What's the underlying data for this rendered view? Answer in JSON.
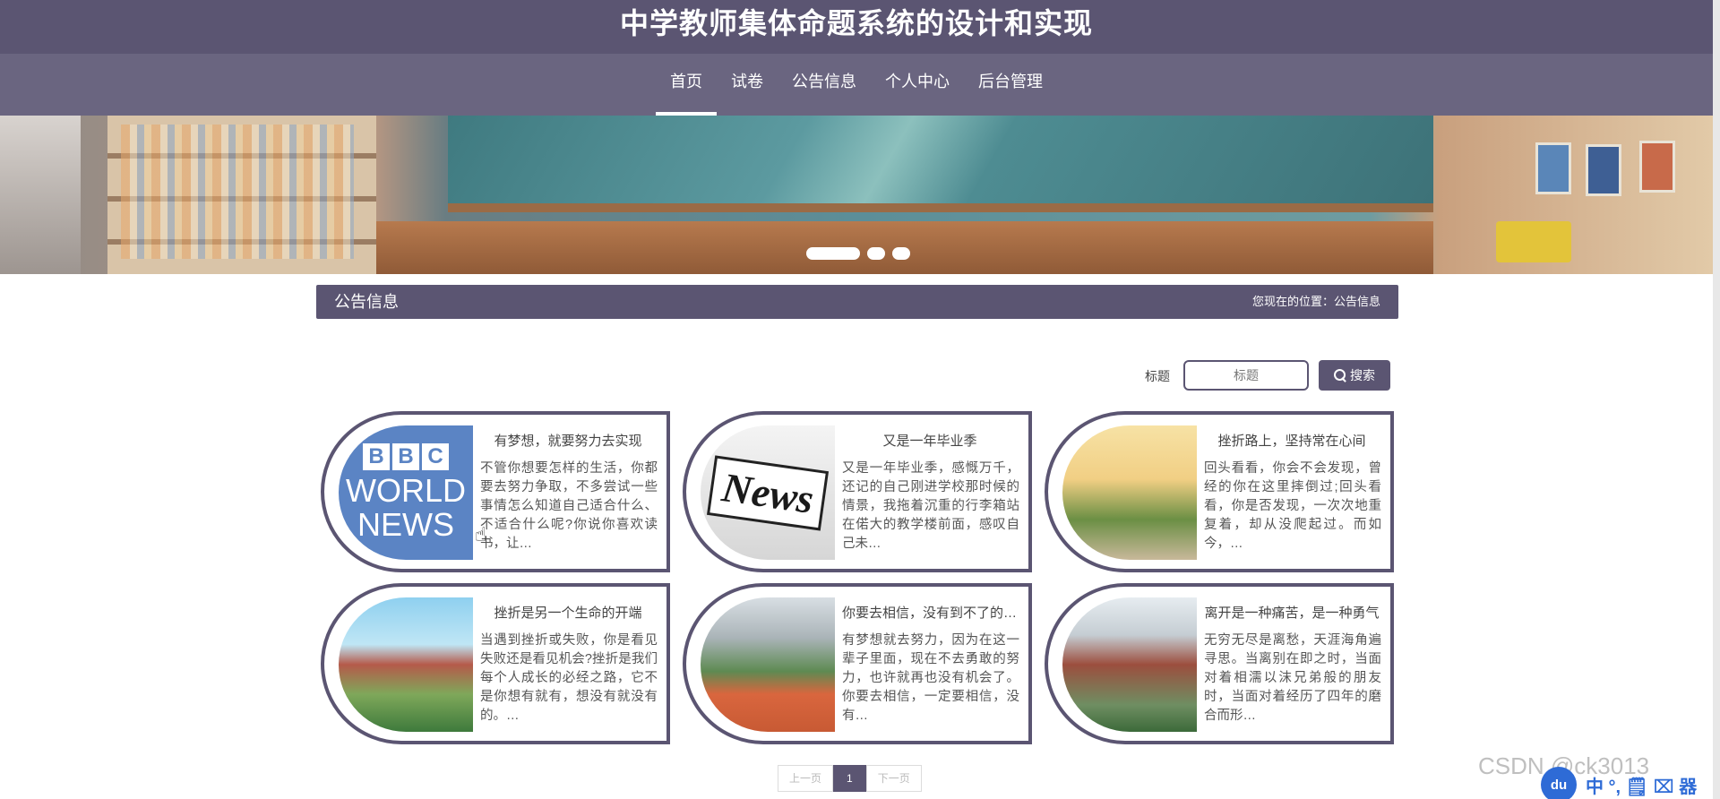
{
  "header": {
    "title": "中学教师集体命题系统的设计和实现"
  },
  "nav": {
    "items": [
      {
        "label": "首页",
        "active": true
      },
      {
        "label": "试卷",
        "active": false
      },
      {
        "label": "公告信息",
        "active": false
      },
      {
        "label": "个人中心",
        "active": false
      },
      {
        "label": "后台管理",
        "active": false
      }
    ]
  },
  "banner": {
    "slides": 3,
    "active_slide": 1
  },
  "section": {
    "title": "公告信息",
    "breadcrumb": "您现在的位置：公告信息"
  },
  "search": {
    "label": "标题",
    "placeholder": "标题",
    "button_label": "搜索"
  },
  "cards": [
    {
      "title": "有梦想，就要努力去实现",
      "text": "不管你想要怎样的生活，你都要去努力争取，不多尝试一些事情怎么知道自己适合什么、不适合什么呢?你说你喜欢读书，让…",
      "image_icon": "bbc-world-news-logo"
    },
    {
      "title": "又是一年毕业季",
      "text": "又是一年毕业季，感慨万千，还记的自己刚进学校那时候的情景，我拖着沉重的行李箱站在偌大的教学楼前面，感叹自己未…",
      "image_icon": "news-newspaper"
    },
    {
      "title": "挫折路上，坚持常在心间",
      "text": "回头看看，你会不会发现，曾经的你在这里摔倒过;回头看看，你是否发现，一次次地重复着，却从没爬起过。而如今，…",
      "image_icon": "campus-trees"
    },
    {
      "title": "挫折是另一个生命的开端",
      "text": "当遇到挫折或失败，你是看见失败还是看见机会?挫折是我们每个人成长的必经之路，它不是你想有就有，想没有就没有的。…",
      "image_icon": "campus-building"
    },
    {
      "title": "你要去相信，没有到不了的明天",
      "text": "有梦想就去努力，因为在这一辈子里面，现在不去勇敢的努力，也许就再也没有机会了。你要去相信，一定要相信，没有…",
      "image_icon": "sports-field"
    },
    {
      "title": "离开是一种痛苦，是一种勇气",
      "text": "无穷无尽是离愁，天涯海角遍寻思。当离别在即之时，当面对着相濡以沫兄弟般的朋友时，当面对着经历了四年的磨合而形…",
      "image_icon": "campus-gate"
    }
  ],
  "pager": {
    "prev": "上一页",
    "current": "1",
    "next": "下一页"
  },
  "overlay": {
    "watermark": "CSDN @ck3013",
    "tray_icon": "du",
    "tray_text": "中 °, 🗒 ⌧ 器"
  },
  "colors": {
    "primary": "#5b5572",
    "nav_bg": "#6a6580"
  }
}
